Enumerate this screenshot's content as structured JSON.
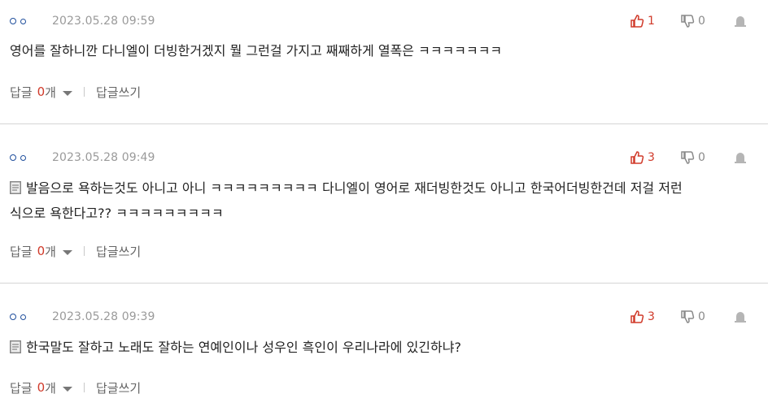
{
  "comments": [
    {
      "date": "2023.05.28 09:59",
      "likes": "1",
      "dislikes": "0",
      "has_doc_icon": false,
      "lines": [
        "영어를 잘하니깐 다니엘이 더빙한거겠지 뭘 그런걸 가지고 째째하게 열폭은 ㅋㅋㅋㅋㅋㅋㅋ"
      ],
      "reply_label": "답글",
      "reply_count": "0",
      "reply_unit": "개",
      "write_label": "답글쓰기"
    },
    {
      "date": "2023.05.28 09:49",
      "likes": "3",
      "dislikes": "0",
      "has_doc_icon": true,
      "lines": [
        "발음으로 욕하는것도 아니고 아니 ㅋㅋㅋㅋㅋㅋㅋㅋㅋ 다니엘이 영어로 재더빙한것도 아니고 한국어더빙한건데 저걸 저런",
        "식으로 욕한다고?? ㅋㅋㅋㅋㅋㅋㅋㅋㅋ"
      ],
      "reply_label": "답글",
      "reply_count": "0",
      "reply_unit": "개",
      "write_label": "답글쓰기"
    },
    {
      "date": "2023.05.28 09:39",
      "likes": "3",
      "dislikes": "0",
      "has_doc_icon": true,
      "lines": [
        "한국말도 잘하고 노래도 잘하는 연예인이나 성우인 흑인이 우리나라에 있긴하냐?"
      ],
      "reply_label": "답글",
      "reply_count": "0",
      "reply_unit": "개",
      "write_label": "답글쓰기"
    }
  ],
  "colors": {
    "accent_red": "#d03a2a",
    "author_blue": "#1f4e9c",
    "muted": "#9a9a9a"
  },
  "icons": [
    "thumbs-up-icon",
    "thumbs-down-icon",
    "report-icon",
    "document-icon",
    "chevron-down-icon"
  ]
}
